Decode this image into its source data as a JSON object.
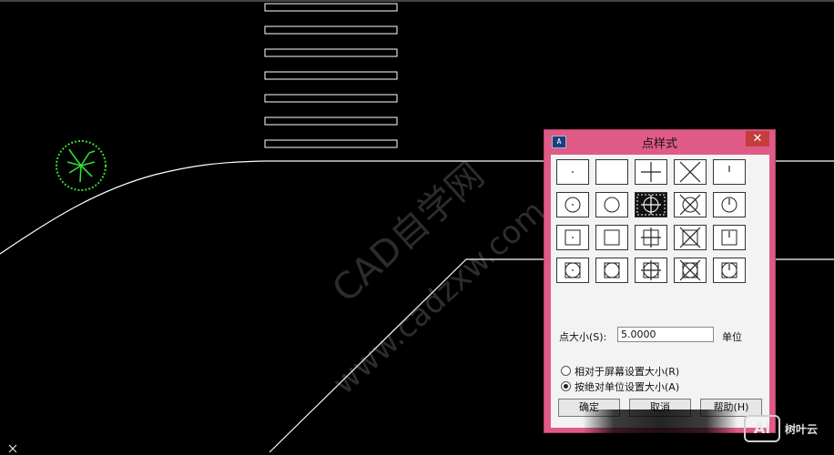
{
  "dialog": {
    "title": "点样式",
    "close_glyph": "✕",
    "app_icon_text": "A",
    "styles": [
      [
        "dot",
        "none",
        "plus",
        "x",
        "tick"
      ],
      [
        "circle-dot",
        "circle",
        "circle-plus",
        "circle-x",
        "circle-tick"
      ],
      [
        "square-dot",
        "square",
        "square-plus",
        "square-x",
        "square-tick"
      ],
      [
        "square-circle-dot",
        "square-circle",
        "square-circle-plus",
        "square-circle-x",
        "square-circle-tick"
      ]
    ],
    "selected_style": "circle-plus",
    "size_label": "点大小(S):",
    "size_value": "5.0000",
    "unit_label": "单位",
    "radio_relative": "相对于屏幕设置大小(R)",
    "radio_absolute": "按绝对单位设置大小(A)",
    "radio_selected": "absolute",
    "buttons": {
      "ok": "确定",
      "cancel": "取消",
      "help": "帮助(H)"
    }
  },
  "watermark": {
    "line1": "CAD自学网",
    "line2": "www.cadzxw.com"
  },
  "logo": {
    "badge": "AI",
    "text": "树叶云"
  },
  "colors": {
    "dialog_frame": "#e05a86",
    "cad_background": "#000000",
    "tree_symbol": "#33dd33",
    "cad_lines": "#ffffff"
  },
  "icons": [
    "tree-symbol-icon",
    "app-icon",
    "close-icon"
  ]
}
